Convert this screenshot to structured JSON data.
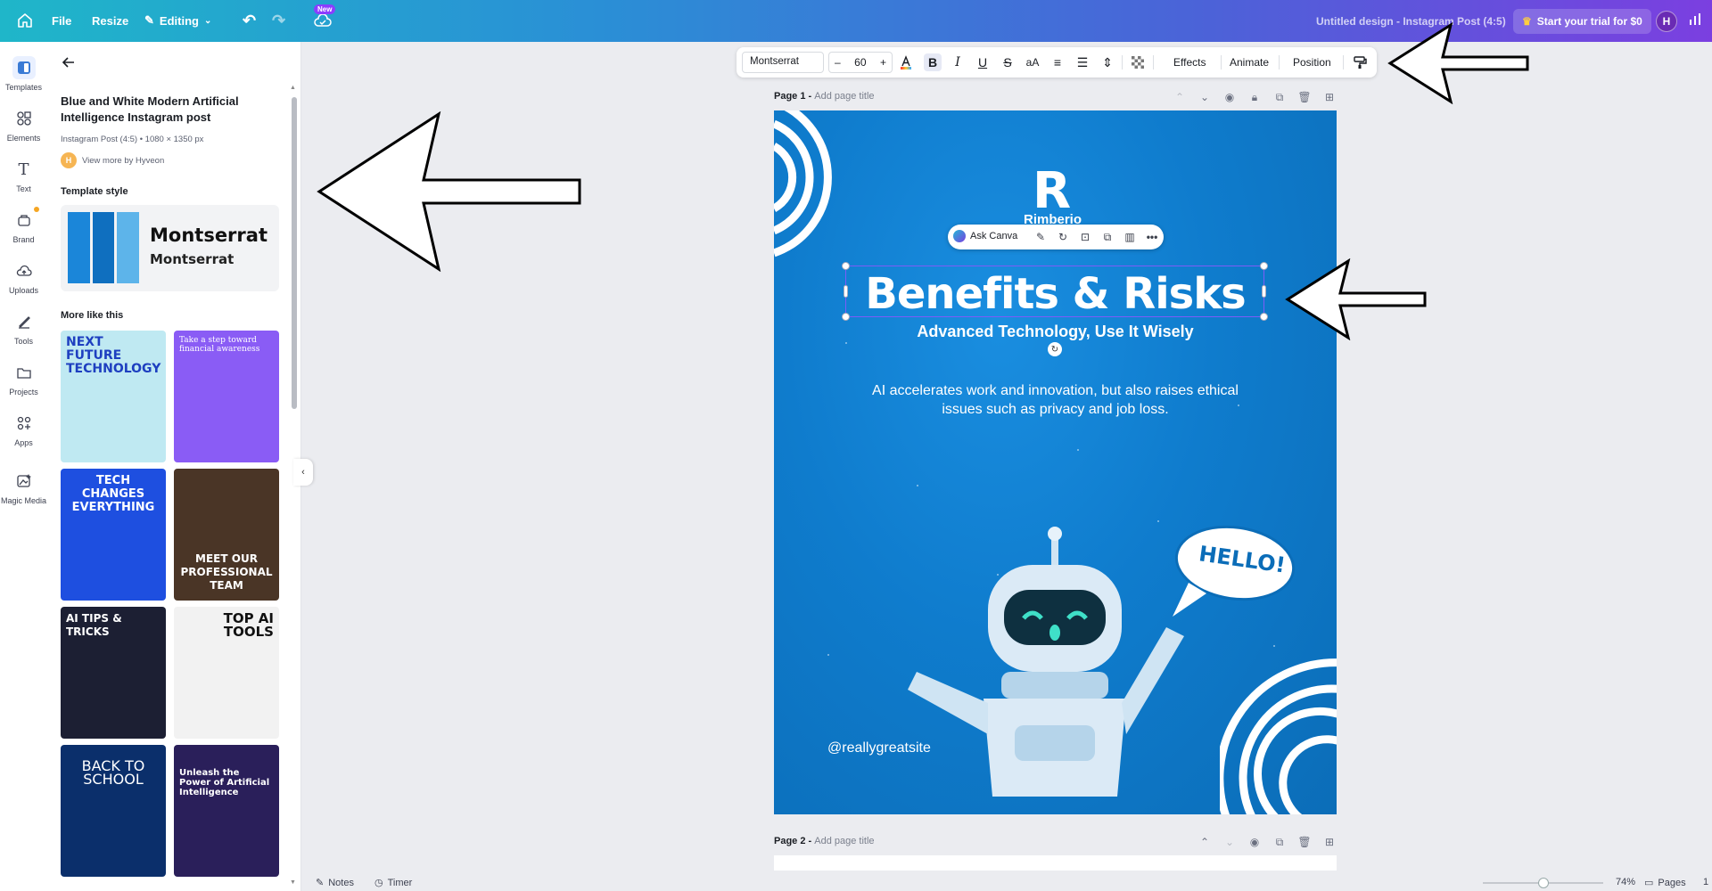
{
  "topbar": {
    "file": "File",
    "resize": "Resize",
    "editing": "Editing",
    "new_badge": "New",
    "design_title": "Untitled design - Instagram Post (4:5)",
    "trial": "Start your trial for $0",
    "avatar": "H"
  },
  "rail": [
    {
      "label": "Templates",
      "icon": "templates-icon"
    },
    {
      "label": "Elements",
      "icon": "elements-icon"
    },
    {
      "label": "Text",
      "icon": "text-icon"
    },
    {
      "label": "Brand",
      "icon": "brand-icon"
    },
    {
      "label": "Uploads",
      "icon": "uploads-icon"
    },
    {
      "label": "Tools",
      "icon": "tools-icon"
    },
    {
      "label": "Projects",
      "icon": "projects-icon"
    },
    {
      "label": "Apps",
      "icon": "apps-icon"
    },
    {
      "label": "Magic Media",
      "icon": "magic-media-icon"
    }
  ],
  "panel": {
    "title": "Blue and White Modern Artificial Intelligence Instagram post",
    "size": "Instagram Post (4:5) • 1080 × 1350 px",
    "author_initial": "H",
    "author": "View more by Hyveon",
    "style_heading": "Template style",
    "style_font_primary": "Montserrat",
    "style_font_secondary": "Montserrat",
    "more_heading": "More like this",
    "thumbs": [
      {
        "text": "NEXT FUTURE TECHNOLOGY",
        "sub": "",
        "bg": "#bfe9f2"
      },
      {
        "text": "Take a step toward financial awareness",
        "sub": "",
        "bg": "#8a5cf5"
      },
      {
        "text": "TECH CHANGES EVERYTHING",
        "sub": "",
        "bg": "#1e4fe0"
      },
      {
        "text": "MEET OUR PROFESSIONAL TEAM",
        "sub": "",
        "bg": "#4a3526"
      },
      {
        "text": "AI TIPS & TRICKS",
        "sub": "",
        "bg": "#1c1f33"
      },
      {
        "text": "TOP AI TOOLS",
        "sub": "",
        "bg": "#f2f2f2"
      },
      {
        "text": "BACK TO SCHOOL",
        "sub": "",
        "bg": "#0b2f6b"
      },
      {
        "text": "Unleash the Power of Artificial Intelligence",
        "sub": "",
        "bg": "#2a1f5a"
      }
    ]
  },
  "format_bar": {
    "font": "Montserrat",
    "size": "60",
    "effects": "Effects",
    "animate": "Animate",
    "position": "Position"
  },
  "page1": {
    "label": "Page 1 -",
    "add_title": "Add page title",
    "logo_letter": "R",
    "logo_name": "Rimberio",
    "headline": "Benefits & Risks",
    "subhead": "Advanced Technology, Use It Wisely",
    "body": "AI accelerates work and innovation, but also raises ethical issues such as privacy and job loss.",
    "bubble": "HELLO!",
    "handle": "@reallygreatsite"
  },
  "context_bar": {
    "ask": "Ask Canva"
  },
  "page2": {
    "label": "Page 2 -",
    "add_title": "Add page title"
  },
  "status": {
    "notes": "Notes",
    "timer": "Timer",
    "zoom": "74%",
    "pages": "Pages",
    "page_num": "1"
  },
  "colors": {
    "accent": "#8b3dff",
    "canvas_blue": "#0f7ccd",
    "selection": "#7d5cf6"
  }
}
